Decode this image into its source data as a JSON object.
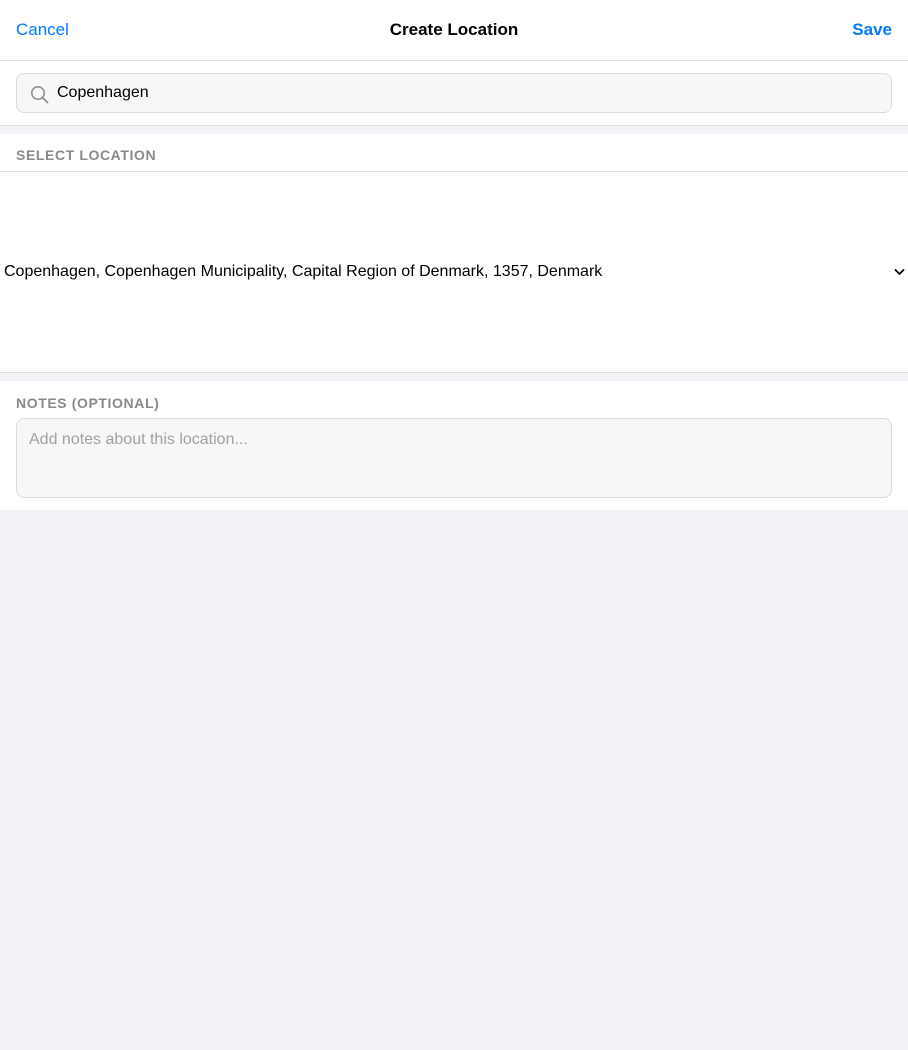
{
  "nav": {
    "cancel_label": "Cancel",
    "title": "Create Location",
    "save_label": "Save"
  },
  "search": {
    "icon": "search-icon",
    "value": "Copenhagen"
  },
  "location": {
    "header": "SELECT LOCATION",
    "selected": "Copenhagen, Copenhagen Municipality, Capital Region of Denmark, 1357, Denmark",
    "chevron_icon": "chevron-down-icon"
  },
  "notes": {
    "header": "NOTES (OPTIONAL)",
    "placeholder": "Add notes about this location..."
  },
  "colors": {
    "accent": "#007aff",
    "background": "#f2f2f7",
    "section_header": "#8a8a8e"
  }
}
